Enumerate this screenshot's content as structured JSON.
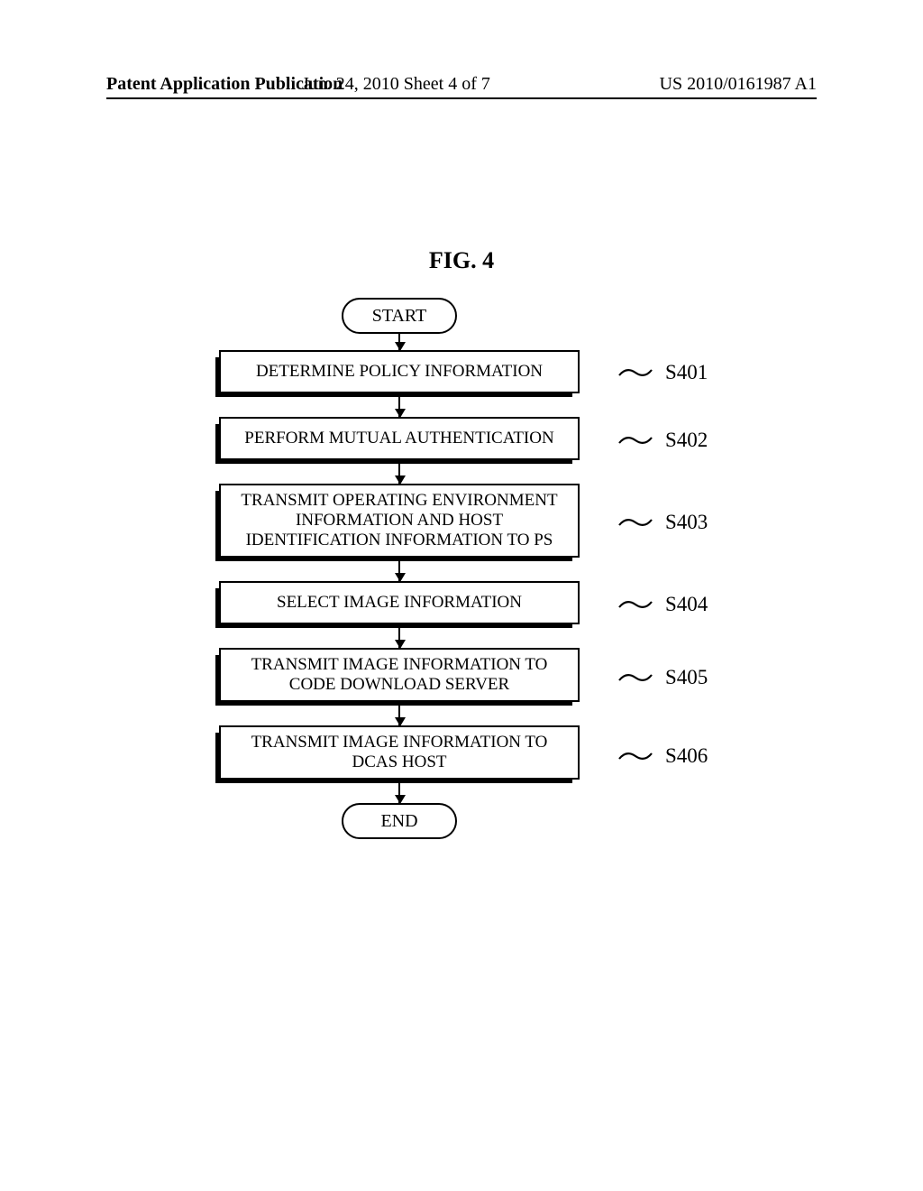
{
  "header": {
    "left": "Patent Application Publication",
    "mid": "Jun. 24, 2010  Sheet 4 of 7",
    "right": "US 2010/0161987 A1"
  },
  "figure_title": "FIG. 4",
  "terminals": {
    "start": "START",
    "end": "END"
  },
  "steps": [
    {
      "id": "S401",
      "text": "DETERMINE POLICY INFORMATION",
      "lines": 1
    },
    {
      "id": "S402",
      "text": "PERFORM MUTUAL AUTHENTICATION",
      "lines": 1
    },
    {
      "id": "S403",
      "text": "TRANSMIT OPERATING ENVIRONMENT INFORMATION AND HOST IDENTIFICATION INFORMATION TO PS",
      "lines": 3
    },
    {
      "id": "S404",
      "text": "SELECT IMAGE INFORMATION",
      "lines": 1
    },
    {
      "id": "S405",
      "text": "TRANSMIT IMAGE INFORMATION TO CODE DOWNLOAD SERVER",
      "lines": 2
    },
    {
      "id": "S406",
      "text": "TRANSMIT IMAGE INFORMATION TO DCAS HOST",
      "lines": 2
    }
  ],
  "chart_data": {
    "type": "flowchart",
    "title": "FIG. 4",
    "nodes": [
      {
        "id": "start",
        "type": "terminator",
        "label": "START"
      },
      {
        "id": "S401",
        "type": "process",
        "label": "DETERMINE POLICY INFORMATION"
      },
      {
        "id": "S402",
        "type": "process",
        "label": "PERFORM MUTUAL AUTHENTICATION"
      },
      {
        "id": "S403",
        "type": "process",
        "label": "TRANSMIT OPERATING ENVIRONMENT INFORMATION AND HOST IDENTIFICATION INFORMATION TO PS"
      },
      {
        "id": "S404",
        "type": "process",
        "label": "SELECT IMAGE INFORMATION"
      },
      {
        "id": "S405",
        "type": "process",
        "label": "TRANSMIT IMAGE INFORMATION TO CODE DOWNLOAD SERVER"
      },
      {
        "id": "S406",
        "type": "process",
        "label": "TRANSMIT IMAGE INFORMATION TO DCAS HOST"
      },
      {
        "id": "end",
        "type": "terminator",
        "label": "END"
      }
    ],
    "edges": [
      {
        "from": "start",
        "to": "S401"
      },
      {
        "from": "S401",
        "to": "S402"
      },
      {
        "from": "S402",
        "to": "S403"
      },
      {
        "from": "S403",
        "to": "S404"
      },
      {
        "from": "S404",
        "to": "S405"
      },
      {
        "from": "S405",
        "to": "S406"
      },
      {
        "from": "S406",
        "to": "end"
      }
    ]
  }
}
